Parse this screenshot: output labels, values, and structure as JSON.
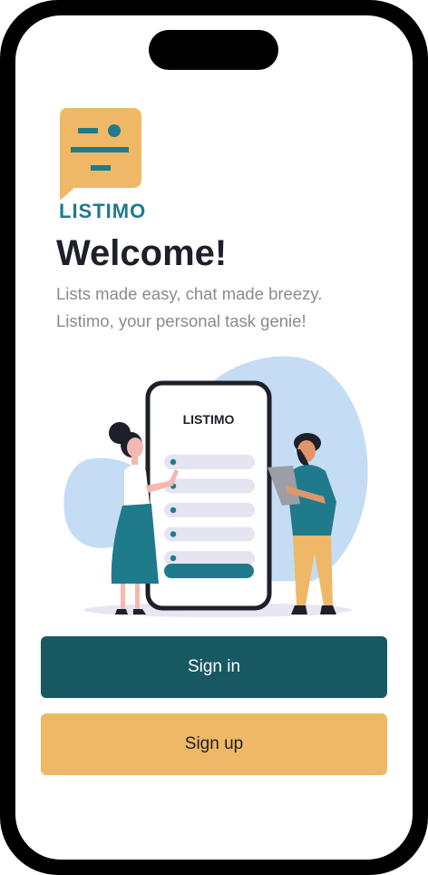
{
  "app": {
    "brand": "LISTIMO",
    "welcome_title": "Welcome!",
    "subtitle_line1": "Lists made easy, chat made breezy.",
    "subtitle_line2": "Listimo, your personal task genie!"
  },
  "illustration": {
    "phone_brand": "LISTIMO",
    "list_item_count": 5
  },
  "actions": {
    "sign_in_label": "Sign in",
    "sign_up_label": "Sign up"
  },
  "colors": {
    "brand_teal": "#1f7a8c",
    "dark_teal": "#175863",
    "accent_orange": "#efb866",
    "title_dark": "#1d1f2b",
    "subtitle_gray": "#8a8a8f",
    "blob_blue": "#c4ddf4"
  },
  "icons": {
    "logo": "chat-bubble-list-icon"
  }
}
